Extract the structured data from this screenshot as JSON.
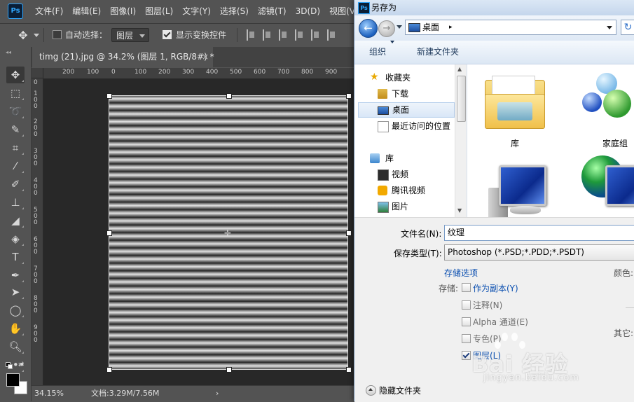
{
  "photoshop": {
    "logo": "Ps",
    "menu": [
      "文件(F)",
      "编辑(E)",
      "图像(I)",
      "图层(L)",
      "文字(Y)",
      "选择(S)",
      "滤镜(T)",
      "3D(D)",
      "视图(V)"
    ],
    "options": {
      "auto_select_label": "自动选择：",
      "auto_select_checked": false,
      "auto_select_target": "图层",
      "show_transform_label": "显示变换控件",
      "show_transform_checked": true
    },
    "doc_tab": {
      "title": "timg (21).jpg @ 34.2% (图层 1, RGB/8#) *",
      "close": "×"
    },
    "ruler_top_labels": [
      "200",
      "100",
      "0",
      "100",
      "200",
      "300",
      "400",
      "500",
      "600",
      "700",
      "800",
      "900"
    ],
    "ruler_left_labels": [
      "0",
      "100",
      "200",
      "300",
      "400",
      "500",
      "600",
      "700",
      "800",
      "900"
    ],
    "status": {
      "zoom": "34.15%",
      "doc_info": "文档:3.29M/7.56M",
      "more": "›"
    },
    "canvas_stripes": {
      "count": 36,
      "colors": [
        "#262626",
        "#e3e3e3"
      ]
    }
  },
  "dialog": {
    "title": "另存为",
    "title_icon": "Ps",
    "address": {
      "location": "桌面",
      "separator": "▸"
    },
    "commands": {
      "organize": "组织",
      "new_folder": "新建文件夹"
    },
    "nav_pane": {
      "favorites": "收藏夹",
      "items": [
        "下载",
        "桌面",
        "最近访问的位置"
      ],
      "libraries": "库",
      "library_items": [
        "视频",
        "腾讯视频",
        "图片"
      ]
    },
    "content_items": [
      {
        "label": "库",
        "icon": "library-folder-icon"
      },
      {
        "label": "家庭组",
        "icon": "homegroup-icon"
      },
      {
        "label": "",
        "icon": "computer-icon"
      },
      {
        "label": "",
        "icon": "network-icon"
      }
    ],
    "form": {
      "filename_label": "文件名(N):",
      "filename_value": "纹理",
      "filetype_label": "保存类型(T):",
      "filetype_value": "Photoshop (*.PSD;*.PDD;*.PSDT)",
      "save_options_link": "存储选项",
      "save_label": "存储:",
      "as_copy": "作为副本(Y)",
      "notes": "注释(N)",
      "alpha": "Alpha 通道(E)",
      "spot": "专色(P)",
      "layers": "图层(L)",
      "color_label": "颜色:",
      "other_label": "其它:",
      "hide_folders": "隐藏文件夹"
    }
  },
  "watermark": {
    "brand": "Bai 经验",
    "url": "jingyan.baidu.com"
  }
}
